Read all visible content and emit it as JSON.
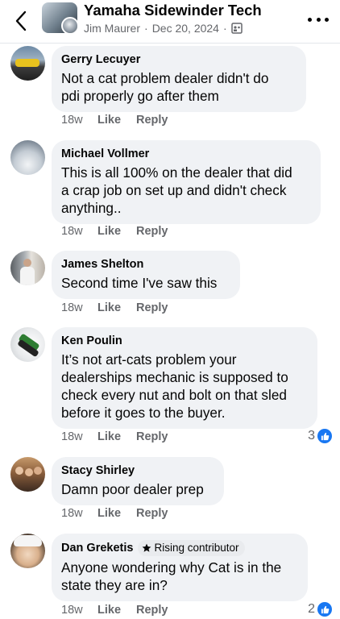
{
  "header": {
    "title": "Yamaha Sidewinder Tech",
    "author": "Jim Maurer",
    "sep1": "·",
    "date": "Dec 20, 2024",
    "sep2": "·"
  },
  "comments": [
    {
      "author": "Gerry Lecuyer",
      "lines": [
        "Not a cat problem  dealer didn't  do",
        "pdi properly  go after them"
      ],
      "time": "18w",
      "like": "Like",
      "reply": "Reply"
    },
    {
      "author": "Michael Vollmer",
      "lines": [
        "This is all 100% on the dealer that did",
        "a crap job on set up and didn't check",
        "anything.."
      ],
      "time": "18w",
      "like": "Like",
      "reply": "Reply"
    },
    {
      "author": "James Shelton",
      "lines": [
        "Second time I've saw this"
      ],
      "time": "18w",
      "like": "Like",
      "reply": "Reply"
    },
    {
      "author": "Ken Poulin",
      "lines": [
        "It’s not art-cats problem your",
        "dealerships mechanic is supposed to",
        "check every nut and bolt on that sled",
        "before it goes to the buyer."
      ],
      "time": "18w",
      "like": "Like",
      "reply": "Reply",
      "reaction_count": "3"
    },
    {
      "author": "Stacy Shirley",
      "lines": [
        "Damn poor dealer prep"
      ],
      "time": "18w",
      "like": "Like",
      "reply": "Reply"
    },
    {
      "author": "Dan Greketis",
      "badge": "Rising contributor",
      "lines": [
        "Anyone wondering why Cat is in the",
        "state they are in?"
      ],
      "time": "18w",
      "like": "Like",
      "reply": "Reply",
      "reaction_count": "2"
    }
  ],
  "colors": {
    "bubble": "#f0f2f5",
    "meta": "#65676b",
    "like_blue": "#1877f2"
  }
}
